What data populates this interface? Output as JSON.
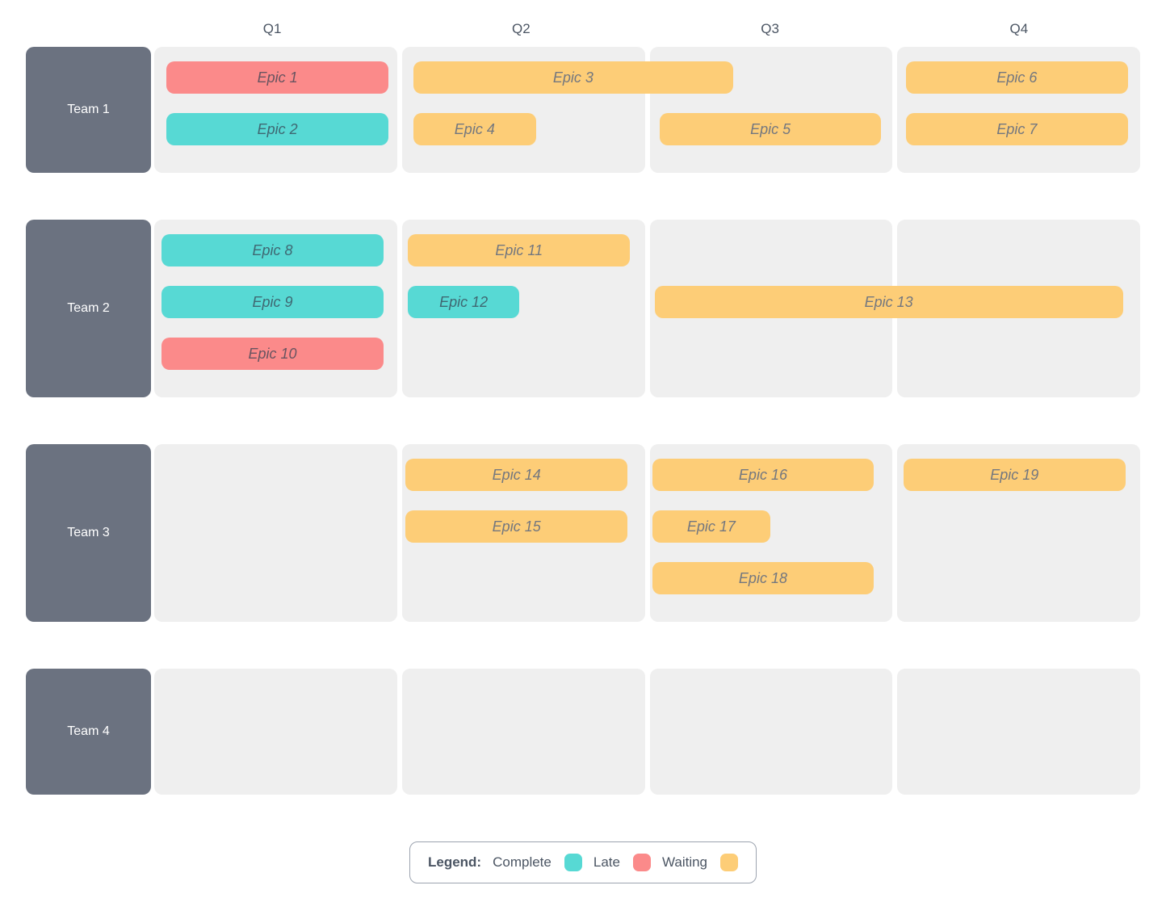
{
  "columns": [
    "Q1",
    "Q2",
    "Q3",
    "Q4"
  ],
  "colors": {
    "complete": "#57d9d4",
    "late": "#fb8a8a",
    "waiting": "#fdcd77",
    "teamCell": "#6b7280",
    "cellBg": "#efefef"
  },
  "teams": [
    {
      "name": "Team 1",
      "rows": 2,
      "epics": [
        {
          "label": "Epic 1",
          "status": "late",
          "row": 0,
          "startQ": 0,
          "spanQ": 0.9,
          "inset": 0.05
        },
        {
          "label": "Epic 2",
          "status": "complete",
          "row": 1,
          "startQ": 0,
          "spanQ": 0.9,
          "inset": 0.05
        },
        {
          "label": "Epic 3",
          "status": "waiting",
          "row": 0,
          "startQ": 1,
          "spanQ": 1.3,
          "inset": 0.05
        },
        {
          "label": "Epic 4",
          "status": "waiting",
          "row": 1,
          "startQ": 1,
          "spanQ": 0.5,
          "inset": 0.05
        },
        {
          "label": "Epic 5",
          "status": "waiting",
          "row": 1,
          "startQ": 2,
          "spanQ": 0.9,
          "inset": 0.05
        },
        {
          "label": "Epic 6",
          "status": "waiting",
          "row": 0,
          "startQ": 3,
          "spanQ": 0.9,
          "inset": 0.05
        },
        {
          "label": "Epic 7",
          "status": "waiting",
          "row": 1,
          "startQ": 3,
          "spanQ": 0.9,
          "inset": 0.05
        }
      ]
    },
    {
      "name": "Team 2",
      "rows": 3,
      "epics": [
        {
          "label": "Epic 8",
          "status": "complete",
          "row": 0,
          "startQ": 0,
          "spanQ": 0.9,
          "inset": 0.03
        },
        {
          "label": "Epic 9",
          "status": "complete",
          "row": 1,
          "startQ": 0,
          "spanQ": 0.9,
          "inset": 0.03
        },
        {
          "label": "Epic 10",
          "status": "late",
          "row": 2,
          "startQ": 0,
          "spanQ": 0.9,
          "inset": 0.03
        },
        {
          "label": "Epic 11",
          "status": "waiting",
          "row": 0,
          "startQ": 1,
          "spanQ": 0.9,
          "inset": 0.03
        },
        {
          "label": "Epic 12",
          "status": "complete",
          "row": 1,
          "startQ": 1,
          "spanQ": 0.45,
          "inset": 0.03
        },
        {
          "label": "Epic 13",
          "status": "waiting",
          "row": 1,
          "startQ": 2,
          "spanQ": 1.9,
          "inset": 0.03
        }
      ]
    },
    {
      "name": "Team 3",
      "rows": 3,
      "epics": [
        {
          "label": "Epic 14",
          "status": "waiting",
          "row": 0,
          "startQ": 1,
          "spanQ": 0.9,
          "inset": 0.02
        },
        {
          "label": "Epic 15",
          "status": "waiting",
          "row": 1,
          "startQ": 1,
          "spanQ": 0.9,
          "inset": 0.02
        },
        {
          "label": "Epic 16",
          "status": "waiting",
          "row": 0,
          "startQ": 2,
          "spanQ": 0.9,
          "inset": 0.02
        },
        {
          "label": "Epic 17",
          "status": "waiting",
          "row": 1,
          "startQ": 2,
          "spanQ": 0.48,
          "inset": 0.02
        },
        {
          "label": "Epic 18",
          "status": "waiting",
          "row": 2,
          "startQ": 2,
          "spanQ": 0.9,
          "inset": 0.02
        },
        {
          "label": "Epic 19",
          "status": "waiting",
          "row": 0,
          "startQ": 3,
          "spanQ": 0.9,
          "inset": 0.04
        }
      ]
    },
    {
      "name": "Team 4",
      "rows": 2,
      "epics": []
    }
  ],
  "legend": {
    "title": "Legend:",
    "items": [
      {
        "label": "Complete",
        "status": "complete"
      },
      {
        "label": "Late",
        "status": "late"
      },
      {
        "label": "Waiting",
        "status": "waiting"
      }
    ]
  }
}
